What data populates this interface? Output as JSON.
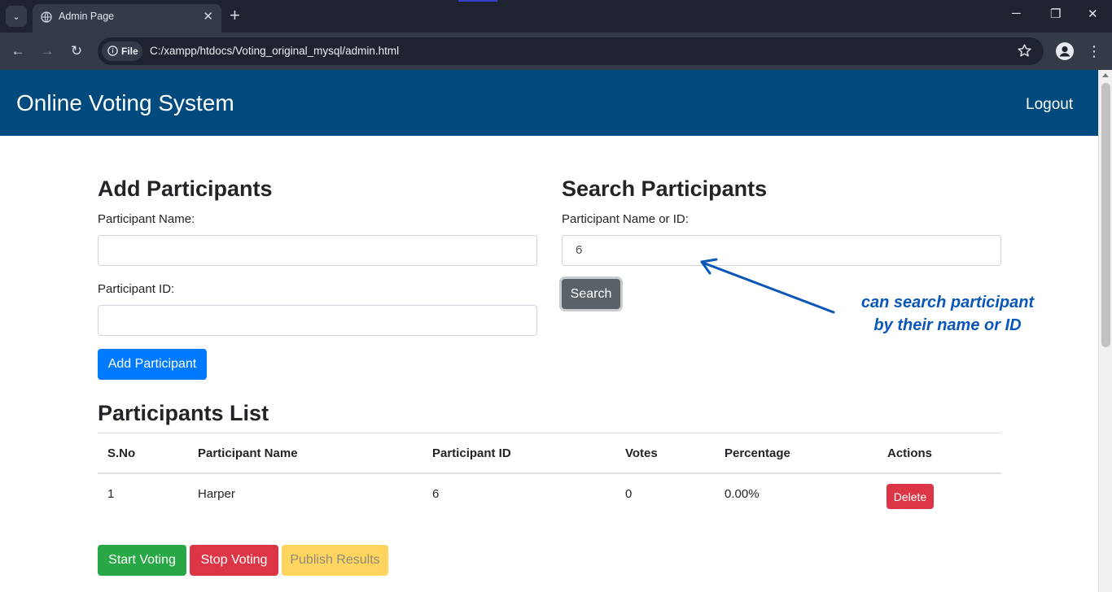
{
  "browser": {
    "tab_title": "Admin Page",
    "tab_close": "✕",
    "new_tab": "+",
    "site_chip": "File",
    "url": "C:/xampp/htdocs/Voting_original_mysql/admin.html",
    "window_controls": {
      "minimize": "─",
      "restore": "❐",
      "close": "✕"
    },
    "nav_icons": {
      "back": "←",
      "forward": "→",
      "reload": "↻",
      "menu": "⋮",
      "tab_list": "⌄"
    }
  },
  "header": {
    "brand": "Online Voting System",
    "logout": "Logout"
  },
  "add_participants": {
    "title": "Add Participants",
    "name_label": "Participant Name:",
    "name_value": "",
    "id_label": "Participant ID:",
    "id_value": "",
    "button": "Add Participant"
  },
  "search_participants": {
    "title": "Search Participants",
    "label": "Participant Name or ID:",
    "value": "6",
    "button": "Search"
  },
  "annotation": {
    "line1": "can search participant",
    "line2": "by their name or ID",
    "color": "#0b57b8"
  },
  "participants_list": {
    "title": "Participants List",
    "columns": [
      "S.No",
      "Participant Name",
      "Participant ID",
      "Votes",
      "Percentage",
      "Actions"
    ],
    "rows": [
      {
        "sno": "1",
        "name": "Harper",
        "id": "6",
        "votes": "0",
        "percentage": "0.00%",
        "action": "Delete"
      }
    ]
  },
  "voting_controls": {
    "start": "Start Voting",
    "stop": "Stop Voting",
    "publish": "Publish Results"
  },
  "colors": {
    "navbar": "#004a7e",
    "primary": "#007bff",
    "secondary": "#5a6268",
    "success": "#28a745",
    "danger": "#dc3545",
    "warning": "#ffd560"
  }
}
